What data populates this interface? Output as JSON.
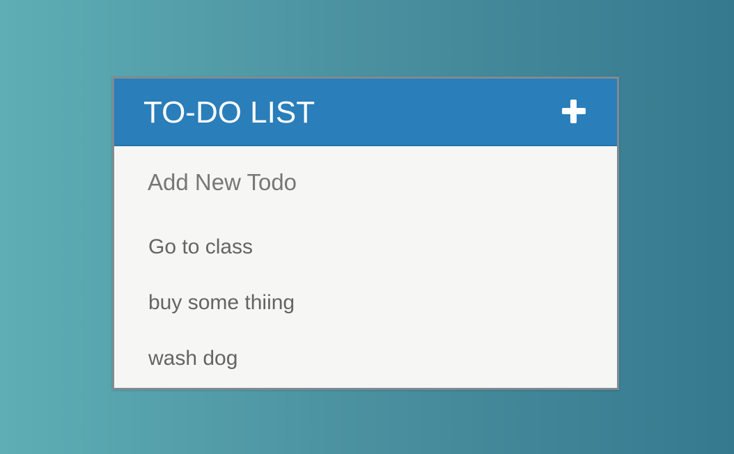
{
  "todo": {
    "title": "TO-DO LIST",
    "add_icon": "plus-icon",
    "new_todo_placeholder": "Add New Todo",
    "new_todo_value": "",
    "items": [
      {
        "text": "Go to class"
      },
      {
        "text": "buy some thiing"
      },
      {
        "text": "wash dog"
      }
    ]
  },
  "colors": {
    "header_bg": "#2a7eba",
    "card_bg": "#f6f6f5",
    "text": "#646464",
    "background_left": "#5eaeb5",
    "background_right": "#35798f"
  }
}
